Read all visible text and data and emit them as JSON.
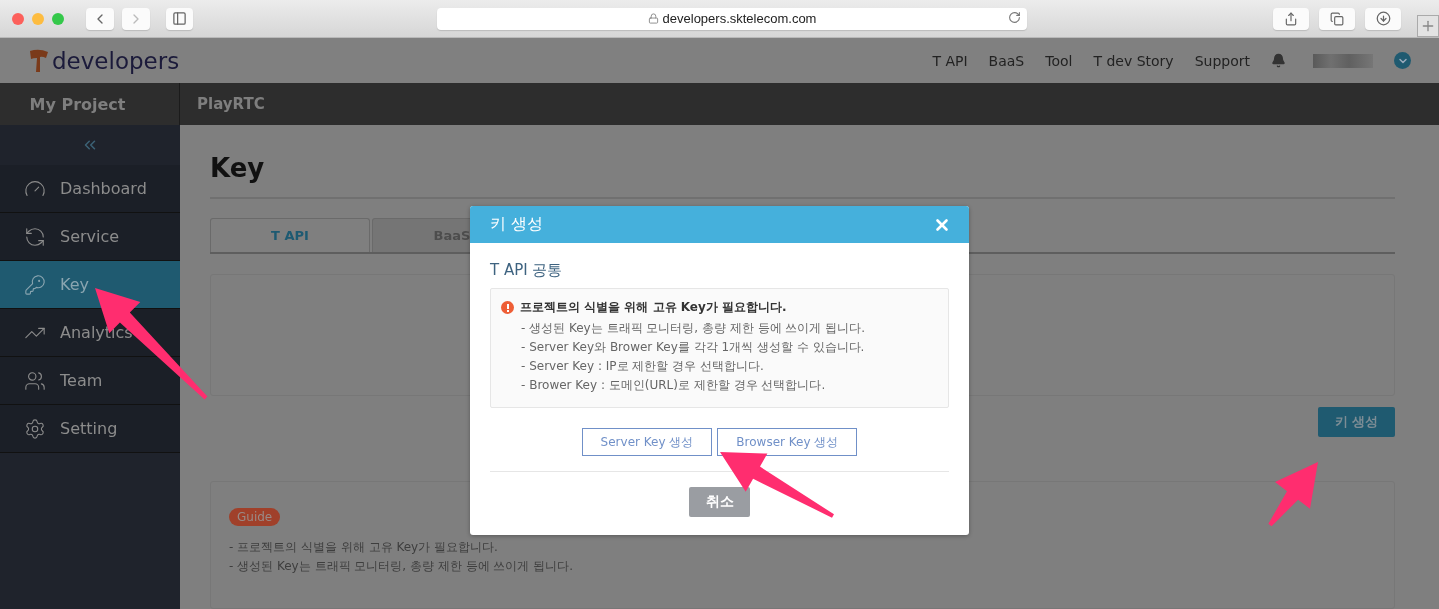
{
  "browser": {
    "url": "developers.sktelecom.com"
  },
  "header": {
    "logo": "developers",
    "nav": [
      {
        "label": "T API"
      },
      {
        "label": "BaaS"
      },
      {
        "label": "Tool"
      },
      {
        "label": "T dev Story"
      },
      {
        "label": "Support"
      }
    ]
  },
  "project_bar": {
    "title": "My Project",
    "project": "PlayRTC"
  },
  "sidebar": {
    "items": [
      {
        "label": "Dashboard",
        "selected": false
      },
      {
        "label": "Service",
        "selected": false
      },
      {
        "label": "Key",
        "selected": true
      },
      {
        "label": "Analytics",
        "selected": false
      },
      {
        "label": "Team",
        "selected": false
      },
      {
        "label": "Setting",
        "selected": false
      }
    ]
  },
  "page": {
    "title": "Key",
    "tabs": [
      {
        "label": "T API",
        "selected": true
      },
      {
        "label": "BaaS",
        "selected": false
      }
    ],
    "create_button": "키 생성",
    "guide": {
      "badge": "Guide",
      "lines": [
        "- 프로젝트의 식별을 위해 고유 Key가 필요합니다.",
        "- 생성된 Key는 트래픽 모니터링, 총량 제한 등에 쓰이게 됩니다."
      ]
    }
  },
  "modal": {
    "title": "키 생성",
    "section": "T API 공통",
    "notice": {
      "heading": "프로젝트의 식별을 위해 고유 Key가 필요합니다.",
      "lines": [
        "- 생성된 Key는 트래픽 모니터링, 총량 제한 등에 쓰이게 됩니다.",
        "- Server Key와 Brower Key를 각각 1개씩 생성할 수 있습니다.",
        "- Server Key : IP로 제한할 경우 선택합니다.",
        "- Brower Key : 도메인(URL)로 제한할 경우 선택합니다."
      ]
    },
    "buttons": [
      {
        "label": "Server Key 생성"
      },
      {
        "label": "Browser Key 생성"
      }
    ],
    "cancel": "취소"
  }
}
